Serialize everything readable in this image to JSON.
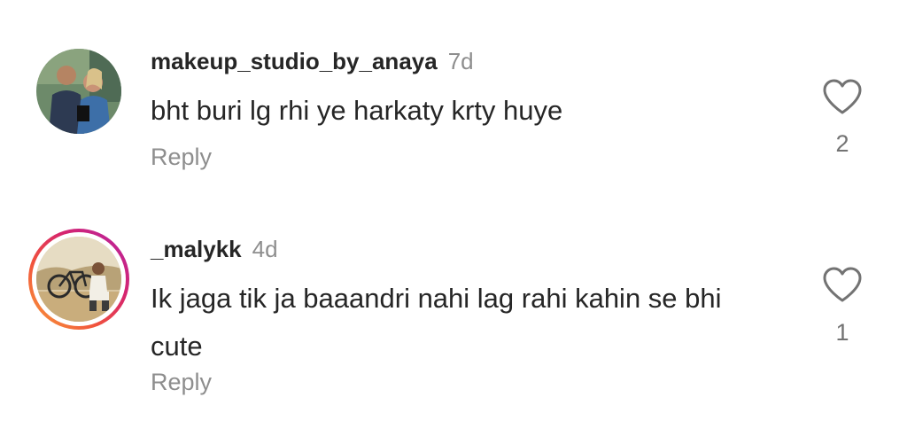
{
  "comments": [
    {
      "username": "makeup_studio_by_anaya",
      "time": "7d",
      "text": "bht buri lg rhi ye harkaty krty huye",
      "reply_label": "Reply",
      "like_count": "2"
    },
    {
      "username": "_malykk",
      "time": "4d",
      "text": "Ik jaga tik ja baaandri nahi lag rahi kahin se bhi cute",
      "reply_label": "Reply",
      "like_count": "1",
      "has_story_ring": true
    }
  ],
  "icons": {
    "like": "heart-outline-icon"
  },
  "colors": {
    "text": "#262626",
    "secondary": "#8e8e8e",
    "story_ring_start": "#f9a23a",
    "story_ring_end": "#b324a8"
  }
}
